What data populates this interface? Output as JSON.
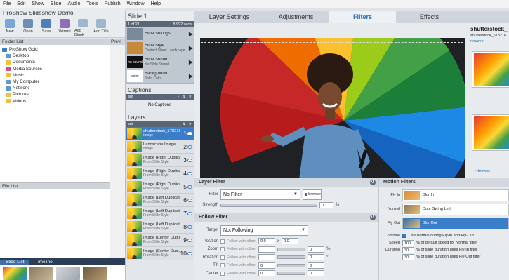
{
  "menu": [
    "File",
    "Edit",
    "Show",
    "Slide",
    "Audio",
    "Tools",
    "Publish",
    "Window",
    "Help"
  ],
  "app_title": "ProShow Slideshow Demo",
  "toolbar": [
    {
      "label": "New",
      "icon": "new-icon",
      "color": "#7aa7d8"
    },
    {
      "label": "Open",
      "icon": "open-icon",
      "color": "#6e8fb5"
    },
    {
      "label": "Save",
      "icon": "save-icon",
      "color": "#4f7fb8"
    },
    {
      "label": "Wizard",
      "icon": "wizard-icon",
      "color": "#8d6fb5"
    },
    {
      "label": "Add Blank",
      "icon": "add-blank-icon",
      "color": "#9fb6cf"
    },
    {
      "label": "Add Title",
      "icon": "add-title-icon",
      "color": "#9fb6cf"
    }
  ],
  "folder_list": {
    "title": "Folder List",
    "items": [
      {
        "label": "ProShow Gold",
        "icon": "proshow-icon",
        "color": "#3a7dc9",
        "indent": 0
      },
      {
        "label": "Desktop",
        "icon": "desktop-icon",
        "color": "#5a9bd6",
        "indent": 1
      },
      {
        "label": "Documents",
        "icon": "documents-icon",
        "color": "#f0c040",
        "indent": 1
      },
      {
        "label": "Media Sources",
        "icon": "media-sources-icon",
        "color": "#d94a8c",
        "indent": 1
      },
      {
        "label": "Music",
        "icon": "music-icon",
        "color": "#f0c040",
        "indent": 1
      },
      {
        "label": "My Computer",
        "icon": "computer-icon",
        "color": "#5a9bd6",
        "indent": 1
      },
      {
        "label": "Network",
        "icon": "network-icon",
        "color": "#5a9bd6",
        "indent": 1
      },
      {
        "label": "Pictures",
        "icon": "pictures-icon",
        "color": "#f0c040",
        "indent": 1
      },
      {
        "label": "Videos",
        "icon": "videos-icon",
        "color": "#f0c040",
        "indent": 1
      }
    ]
  },
  "preview_col_label": "Previ",
  "file_list": {
    "title": "File List"
  },
  "bottom_tabs": [
    "Slide List",
    "Timeline"
  ],
  "slide": {
    "title": "Slide 1",
    "count": "1 of 21",
    "duration": "8.992 secs",
    "options": [
      {
        "title": "Slide Settings",
        "sub": "",
        "swatch": "#7b8a99"
      },
      {
        "title": "Slide Style",
        "sub": "Contact Sheet Landscape...",
        "swatch": "#c78a3a"
      },
      {
        "title": "Slide Sound",
        "sub": "No Slide Sound",
        "swatch": "#111111",
        "text": "no sound"
      },
      {
        "title": "Background",
        "sub": "Solid Color",
        "swatch": "#ffffff",
        "text": "color"
      }
    ]
  },
  "captions": {
    "title": "Captions",
    "add": "add",
    "empty": "No Captions"
  },
  "layers": {
    "title": "Layers",
    "add": "add",
    "items": [
      {
        "name": "shutterstock_578216...",
        "sub": "Image",
        "num": "1",
        "selected": true
      },
      {
        "name": "Landscape Image",
        "sub": "Image",
        "num": "2"
      },
      {
        "name": "Image (Right Duplicat...",
        "sub": "From Slide Style",
        "num": "3"
      },
      {
        "name": "Image (Right Duplicat...",
        "sub": "From Slide Style",
        "num": "4"
      },
      {
        "name": "Image (Right Duplicat...",
        "sub": "From Slide Style",
        "num": "5"
      },
      {
        "name": "Image (Left Duplicate...",
        "sub": "From Slide Style",
        "num": "6"
      },
      {
        "name": "Image (Left Duplicate...",
        "sub": "From Slide Style",
        "num": "7"
      },
      {
        "name": "Image (Left Duplicate...",
        "sub": "From Slide Style",
        "num": "8"
      },
      {
        "name": "Image (Center Duplic...",
        "sub": "From Slide Style",
        "num": "9"
      },
      {
        "name": "Image (Center Dup...",
        "sub": "From Slide Style",
        "num": "10"
      }
    ]
  },
  "tabs": [
    "Layer Settings",
    "Adjustments",
    "Filters",
    "Effects"
  ],
  "active_tab": 2,
  "media": {
    "name": "shutterstock_",
    "sub": "shutterstock_578216",
    "rename": "rename",
    "browse": "browse"
  },
  "layer_filter": {
    "title": "Layer Filter",
    "filter_label": "Filter",
    "filter_value": "No Filter",
    "browse": "browse",
    "strength_label": "Strength",
    "strength_value": "0",
    "unit": "%"
  },
  "follow_filter": {
    "title": "Follow Filter",
    "target_label": "Target",
    "target_value": "Not Following",
    "check_label": "Follow with offset",
    "rows": [
      {
        "label": "Position",
        "a": "0.0",
        "b": "0.0",
        "mid": "x"
      },
      {
        "label": "Zoom",
        "a": "",
        "b": "0",
        "unit": "%"
      },
      {
        "label": "Rotation",
        "a": "",
        "b": "0",
        "unit": "°"
      },
      {
        "label": "Tilt",
        "a": "0",
        "b": "0"
      },
      {
        "label": "Center",
        "a": "0",
        "b": "0"
      }
    ]
  },
  "motion": {
    "title": "Motion Filters",
    "rows": [
      {
        "label": "Fly In",
        "value": "Blur In",
        "selected": false
      },
      {
        "label": "Normal",
        "value": "Door Swing Left",
        "selected": false
      },
      {
        "label": "Fly Out",
        "value": "Blur Out",
        "selected": true
      }
    ],
    "combine_label": "Combine",
    "combine_text": "Use Normal during Fly-In and Fly-Out",
    "speed_label": "Speed",
    "speed_value": "100",
    "speed_text": "% of default speed for Normal filter",
    "duration_label": "Duration",
    "duration_value": "30",
    "duration_text": "% of slide duration uses Fly-In filter",
    "duration2_value": "30",
    "duration2_text": "% of slide duration uses Fly-Out filter"
  }
}
